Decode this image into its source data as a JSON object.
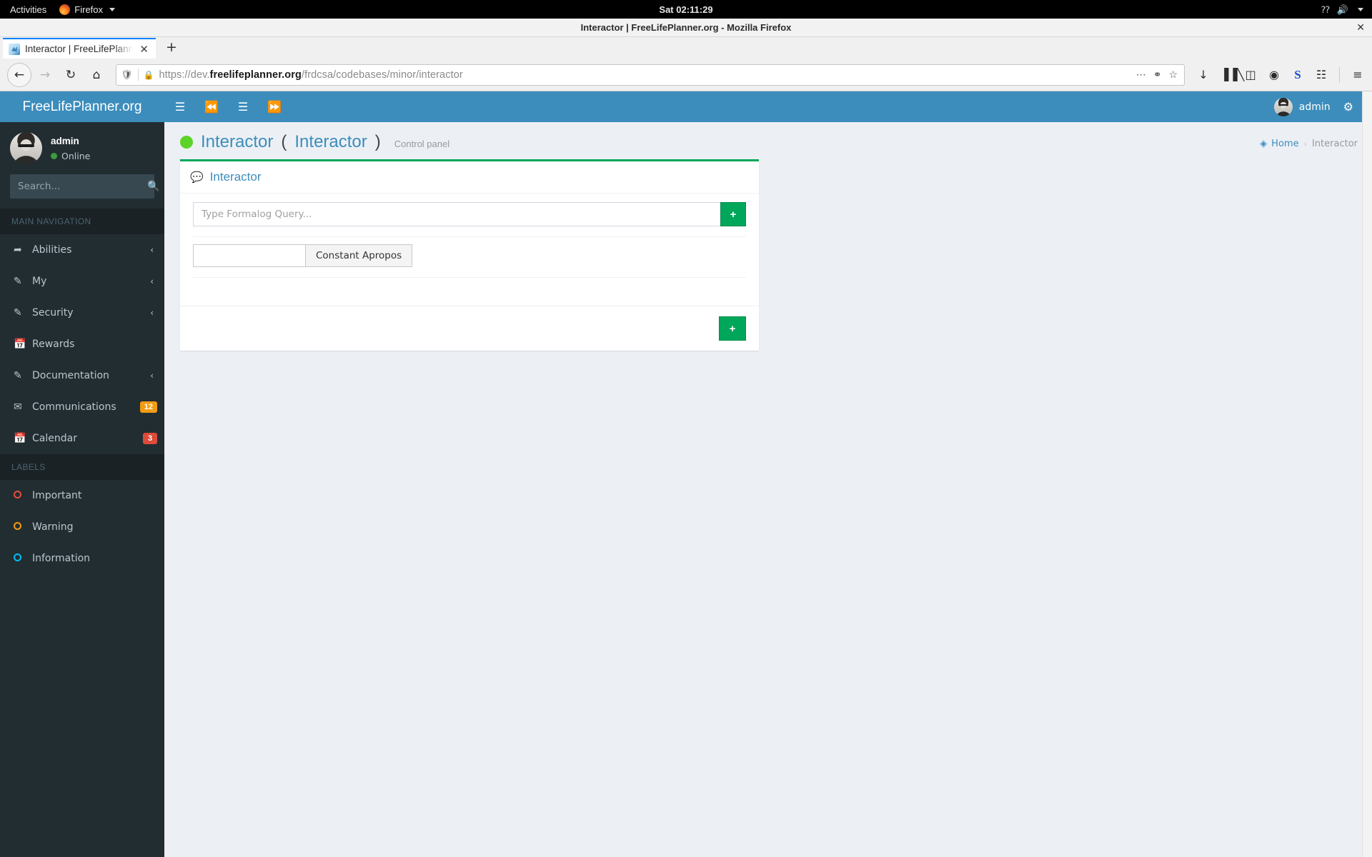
{
  "desktop": {
    "activities": "Activities",
    "app_name": "Firefox",
    "clock": "Sat 02:11:29",
    "tray": {
      "keyboard": "?",
      "volume": "volume-icon",
      "menu": "caret-down"
    }
  },
  "browser": {
    "window_title": "Interactor | FreeLifePlanner.org - Mozilla Firefox",
    "close_label": "✕",
    "tab": {
      "title": "Interactor | FreeLifePlanner.org",
      "close": "✕"
    },
    "new_tab_label": "+",
    "nav": {
      "back": "←",
      "forward": "→",
      "reload": "↻",
      "home": "⌂"
    },
    "url": {
      "prefix": "https://dev.",
      "domain": "freelifeplanner.org",
      "path": "/frdcsa/codebases/minor/interactor",
      "full": "https://dev.freelifeplanner.org/frdcsa/codebases/minor/interactor",
      "shield_icon": "shield-icon",
      "lock_icon": "lock-icon",
      "page_actions_icon": "ellipsis-icon",
      "reader_icon": "pocket-icon",
      "bookmark_icon": "star-icon"
    },
    "toolbar_icons": [
      {
        "name": "downloads-icon",
        "glyph": "↓"
      },
      {
        "name": "library-icon",
        "glyph": "▐▐╲"
      },
      {
        "name": "sidebar-icon",
        "glyph": "◫"
      },
      {
        "name": "account-icon",
        "glyph": "◉"
      },
      {
        "name": "skype-icon",
        "glyph": "S"
      },
      {
        "name": "archive-icon",
        "glyph": "☷"
      },
      {
        "name": "app-menu-icon",
        "glyph": "≡"
      }
    ]
  },
  "sidebar": {
    "brand": "FreeLifePlanner.org",
    "user": {
      "name": "admin",
      "status": "Online",
      "status_color": "#3c9e3c"
    },
    "search": {
      "placeholder": "Search...",
      "value": "",
      "icon": "search-icon"
    },
    "nav_header": "MAIN NAVIGATION",
    "items": [
      {
        "label": "Abilities",
        "icon": "share-icon",
        "arrow": "‹",
        "badge": null
      },
      {
        "label": "My",
        "icon": "edit-icon",
        "arrow": "‹",
        "badge": null
      },
      {
        "label": "Security",
        "icon": "edit-icon",
        "arrow": "‹",
        "badge": null
      },
      {
        "label": "Rewards",
        "icon": "calendar-icon",
        "arrow": "",
        "badge": null
      },
      {
        "label": "Documentation",
        "icon": "edit-icon",
        "arrow": "‹",
        "badge": null
      },
      {
        "label": "Communications",
        "icon": "envelope-icon",
        "arrow": "",
        "badge": "12",
        "badge_color": "orange"
      },
      {
        "label": "Calendar",
        "icon": "calendar-icon",
        "arrow": "",
        "badge": "3",
        "badge_color": "red"
      }
    ],
    "labels_header": "LABELS",
    "labels": [
      {
        "label": "Important",
        "color": "#e74c3c"
      },
      {
        "label": "Warning",
        "color": "#f39c12"
      },
      {
        "label": "Information",
        "color": "#00c0ef"
      }
    ]
  },
  "topnav": {
    "toggle_icon": "bars-icon",
    "buttons": [
      {
        "name": "fast-backward-icon",
        "glyph": "⏪"
      },
      {
        "name": "align-list-icon",
        "glyph": "☰"
      },
      {
        "name": "fast-forward-icon",
        "glyph": "⏩"
      }
    ],
    "user_name": "admin",
    "settings_icon": "gears-icon"
  },
  "page": {
    "title": "Interactor",
    "title_paren_open": "(",
    "title_alt": "Interactor",
    "title_paren_close": ")",
    "subtitle": "Control panel",
    "status_color": "#5cd329",
    "breadcrumb": {
      "home_icon": "dashboard-icon",
      "home": "Home",
      "separator": "›",
      "current": "Interactor"
    }
  },
  "box": {
    "header_icon": "comment-icon",
    "header_title": "Interactor",
    "query": {
      "placeholder": "Type Formalog Query...",
      "value": "",
      "submit_label": "+"
    },
    "apropos": {
      "input_value": "",
      "input_placeholder": "",
      "button_label": "Constant Apropos"
    },
    "footer": {
      "add_label": "+"
    }
  },
  "colors": {
    "brand_blue": "#3c8dbc",
    "sidebar_dark": "#222d32",
    "accent_green": "#00a65a",
    "page_bg": "#ecf0f5",
    "badge_orange": "#f39c12",
    "badge_red": "#dd4b39"
  }
}
